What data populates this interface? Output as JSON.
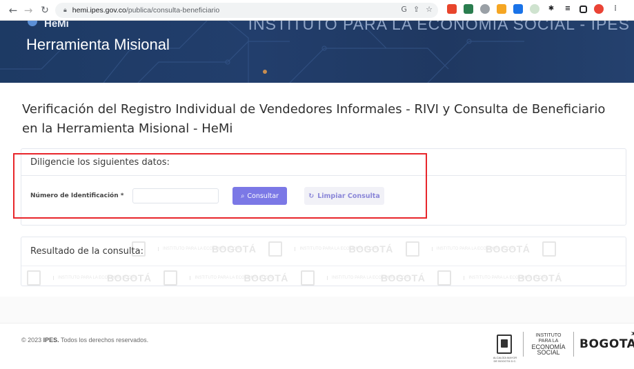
{
  "browser": {
    "url_host": "hemi.ipes.gov.co",
    "url_path": "/publica/consulta-beneficiario"
  },
  "banner": {
    "logo_text": "HeMi",
    "app_title": "Herramienta Misional",
    "institution": "INSTITUTO PARA LA ECONOMÍA SOCIAL - IPES"
  },
  "page": {
    "title": "Verificación del Registro Individual de Vendedores Informales - RIVI y Consulta de Beneficiario en la Herramienta Misional - HeMi"
  },
  "form": {
    "header": "Diligencie los siguientes datos:",
    "id_label": "Número de Identificación *",
    "id_value": "",
    "consultar_label": "Consultar",
    "limpiar_label": "Limpiar Consulta"
  },
  "result": {
    "header": "Resultado de la consulta:"
  },
  "footer": {
    "copyright_prefix": "© 2023",
    "copyright_org": "IPES.",
    "copyright_suffix": "Todos los derechos reservados.",
    "inst_line1": "INSTITUTO PARA LA",
    "inst_line2": "ECONOMÍA",
    "inst_line3": "SOCIAL",
    "bogota": "BOGOTA",
    "alcaldia": "ALCALDÍA MAYOR DE BOGOTÁ D.C."
  },
  "colors": {
    "primary_button": "#7b78e6",
    "banner": "#1f3861",
    "highlight": "#e8252a"
  },
  "icons": [
    "back-icon",
    "forward-icon",
    "reload-icon",
    "lock-icon",
    "search-icon",
    "refresh-icon",
    "star-icon"
  ]
}
